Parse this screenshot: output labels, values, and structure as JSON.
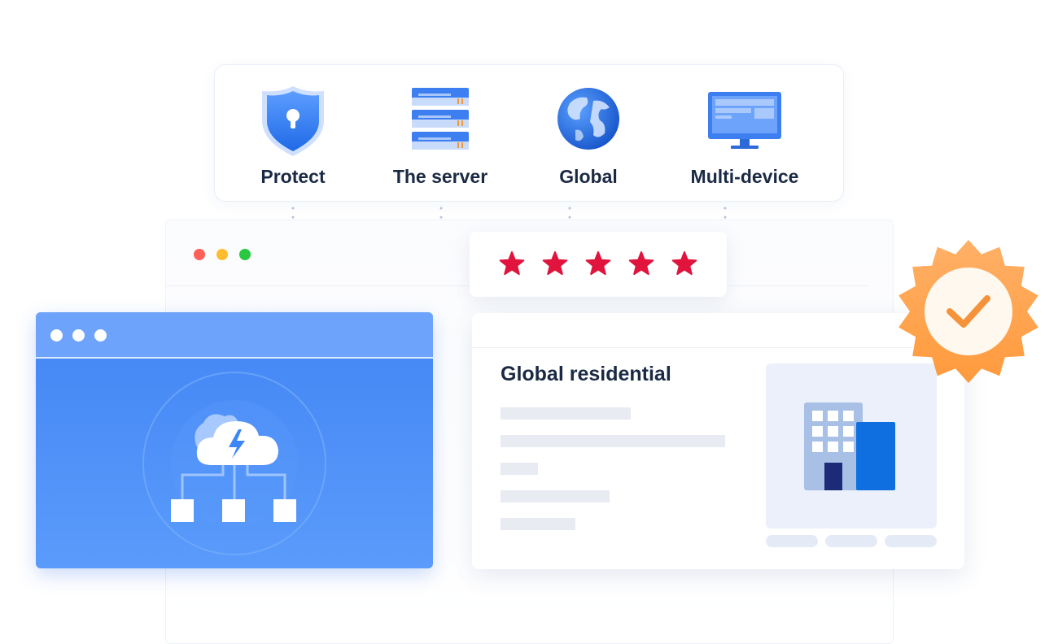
{
  "features": [
    {
      "label": "Protect",
      "icon": "shield-lock-icon"
    },
    {
      "label": "The server",
      "icon": "server-rack-icon"
    },
    {
      "label": "Global",
      "icon": "globe-icon"
    },
    {
      "label": "Multi-device",
      "icon": "monitor-icon"
    }
  ],
  "rating": {
    "stars": 5,
    "max": 5,
    "star_color": "#e0143c"
  },
  "residential": {
    "title": "Global residential",
    "icon": "building-icon"
  },
  "window_controls": [
    "#ff5f57",
    "#febc2e",
    "#28c840"
  ],
  "colors": {
    "accent": "#4285f4",
    "badge": "#ffa94d",
    "text": "#1b2a44"
  },
  "badge": {
    "icon": "verified-check-badge-icon"
  },
  "cloud": {
    "icon": "cloud-lightning-network-icon"
  }
}
